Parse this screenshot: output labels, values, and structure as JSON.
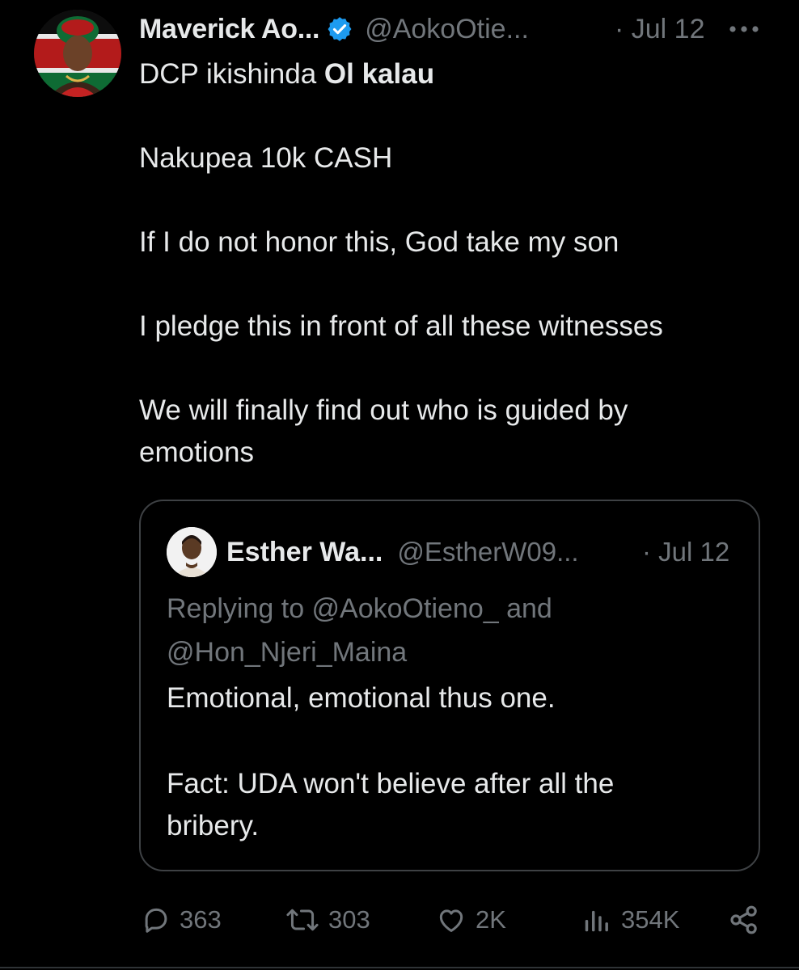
{
  "tweet": {
    "display_name": "Maverick Ao...",
    "handle": "@AokoOtie...",
    "date": "· Jul 12",
    "text": {
      "line1_prefix": "DCP ikishinda ",
      "line1_bold": "Ol kalau",
      "line2": "Nakupea 10k CASH",
      "line3": "If I do not honor this, God take my son",
      "line4": "I pledge this in front of all these witnesses",
      "line5": "We will finally find out who is guided by emotions"
    },
    "icons": {
      "verified": "verified-badge-icon",
      "more": "more-options-icon"
    },
    "colors": {
      "background": "#000000",
      "text": "#e7e9ea",
      "secondary": "#71767b",
      "verified": "#1d9bf0",
      "border": "#3e4144"
    }
  },
  "quote": {
    "display_name": "Esther Wa...",
    "handle": "@EstherW09...",
    "date": "· Jul 12",
    "replying_to": "Replying to @AokoOtieno_ and @Hon_Njeri_Maina",
    "text_line1": "Emotional, emotional thus one.",
    "text_line2": "Fact:  UDA won't believe after all the bribery."
  },
  "actions": {
    "replies": "363",
    "reposts": "303",
    "likes": "2K",
    "views": "354K",
    "icons": [
      "reply-icon",
      "repost-icon",
      "like-icon",
      "views-icon",
      "share-icon"
    ]
  }
}
